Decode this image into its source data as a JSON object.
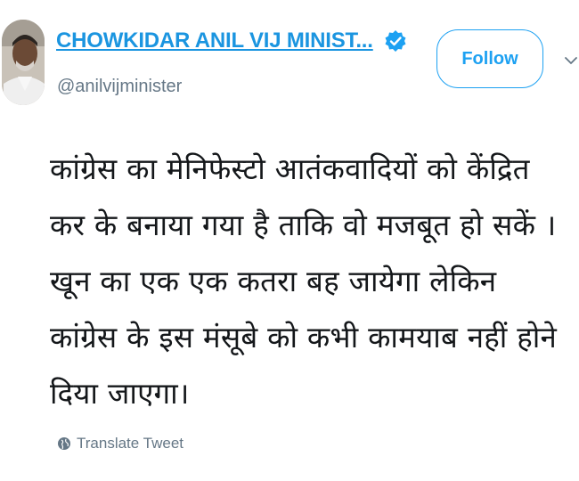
{
  "profile": {
    "display_name": "CHOWKIDAR ANIL VIJ MINIST...",
    "handle": "@anilvijminister",
    "verified_icon": "verified-badge-icon"
  },
  "actions": {
    "follow_label": "Follow",
    "more_icon": "chevron-down-icon"
  },
  "tweet": {
    "text": "कांग्रेस का मेनिफेस्टो आतंकवादियों को केंद्रित\nकर के बनाया  गया है ताकि वो मजबूत हो सकें ।\nखून का एक एक कतरा  बह जायेगा लेकिन\nकांग्रेस के इस मंसूबे को कभी कामयाब नहीं होने\nदिया जाएगा।",
    "translate_label": "Translate Tweet",
    "translate_icon": "globe-icon"
  },
  "colors": {
    "link_blue": "#1b95e0",
    "button_blue": "#1da1f2",
    "secondary_text": "#657786"
  }
}
